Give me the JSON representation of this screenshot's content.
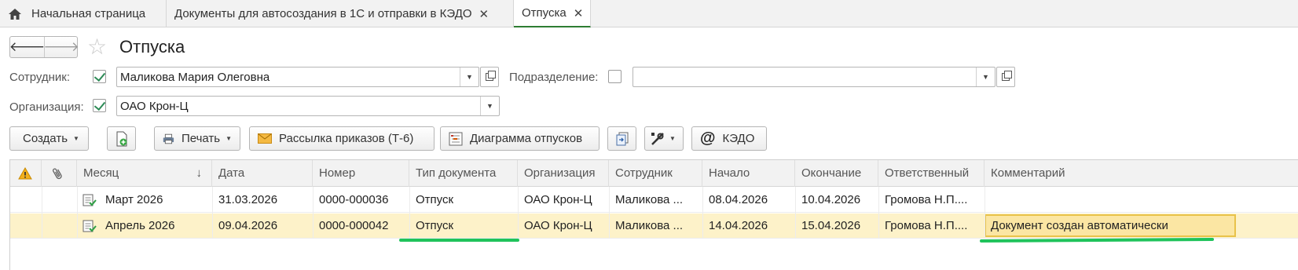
{
  "tabs": [
    {
      "label": "Начальная страница"
    },
    {
      "label": "Документы для автосоздания в 1С и отправки в КЭДО",
      "close": "✕"
    },
    {
      "label": "Отпуска",
      "close": "✕"
    }
  ],
  "page": {
    "title": "Отпуска",
    "nav_back": "🡐",
    "nav_forward": "🡒"
  },
  "filters": {
    "employee": {
      "label": "Сотрудник:",
      "checked": true,
      "value": "Маликова Мария Олеговна"
    },
    "department": {
      "label": "Подразделение:",
      "checked": false,
      "value": ""
    },
    "organization": {
      "label": "Организация:",
      "checked": true,
      "value": "ОАО Крон-Ц"
    }
  },
  "toolbar": {
    "create": "Создать",
    "print": "Печать",
    "mailing": "Рассылка приказов (Т-6)",
    "diagram": "Диаграмма отпусков",
    "kedo": "КЭДО"
  },
  "table": {
    "columns": [
      "Месяц",
      "Дата",
      "Номер",
      "Тип документа",
      "Организация",
      "Сотрудник",
      "Начало",
      "Окончание",
      "Ответственный",
      "Комментарий"
    ],
    "sort_indicator": "↓",
    "rows": [
      {
        "month": "Март 2026",
        "date": "31.03.2026",
        "number": "0000-000036",
        "type": "Отпуск",
        "org": "ОАО Крон-Ц",
        "employee": "Маликова ...",
        "start": "08.04.2026",
        "end": "10.04.2026",
        "responsible": "Громова Н.П....",
        "comment": ""
      },
      {
        "month": "Апрель 2026",
        "date": "09.04.2026",
        "number": "0000-000042",
        "type": "Отпуск",
        "org": "ОАО Крон-Ц",
        "employee": "Маликова ...",
        "start": "14.04.2026",
        "end": "15.04.2026",
        "responsible": "Громова Н.П....",
        "comment": "Документ создан автоматически"
      }
    ]
  },
  "colors": {
    "selected_row": "#fdf2c9",
    "highlight_mark": "#1fc35b",
    "active_tab_underline": "#2e7d32"
  }
}
